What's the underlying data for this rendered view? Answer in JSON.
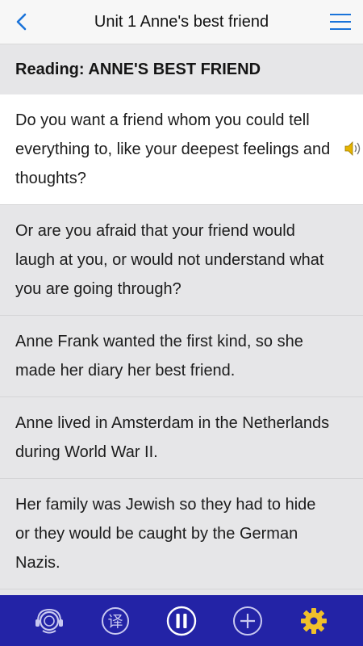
{
  "header": {
    "title": "Unit 1 Anne's best friend"
  },
  "section": {
    "title": "Reading: ANNE'S BEST FRIEND"
  },
  "paragraphs": [
    "Do you want a friend whom you could tell everything to, like your deepest feelings and thoughts?",
    "Or are you afraid that your friend would laugh at you, or would not understand what you are going through?",
    "Anne Frank wanted the first kind, so she made her diary her best friend.",
    "Anne lived in Amsterdam in the Netherlands during World War II.",
    "Her family was Jewish so they had to hide or they would be caught by the German Nazis."
  ],
  "bottom_bar": {
    "translate_glyph": "译"
  },
  "colors": {
    "accent": "#1a73d9",
    "bottom_bar_bg": "#2323a6",
    "icon_light": "#c8c8f0",
    "gear": "#f0c02a",
    "active_row_bg": "#ffffff",
    "row_bg": "#e6e6e8"
  },
  "icons": {
    "back": "chevron-left-icon",
    "menu": "hamburger-menu-icon",
    "speaker": "speaker-icon",
    "listen": "headset-icon",
    "translate": "translate-icon",
    "pause": "pause-icon",
    "add": "plus-icon",
    "settings": "gear-icon"
  }
}
